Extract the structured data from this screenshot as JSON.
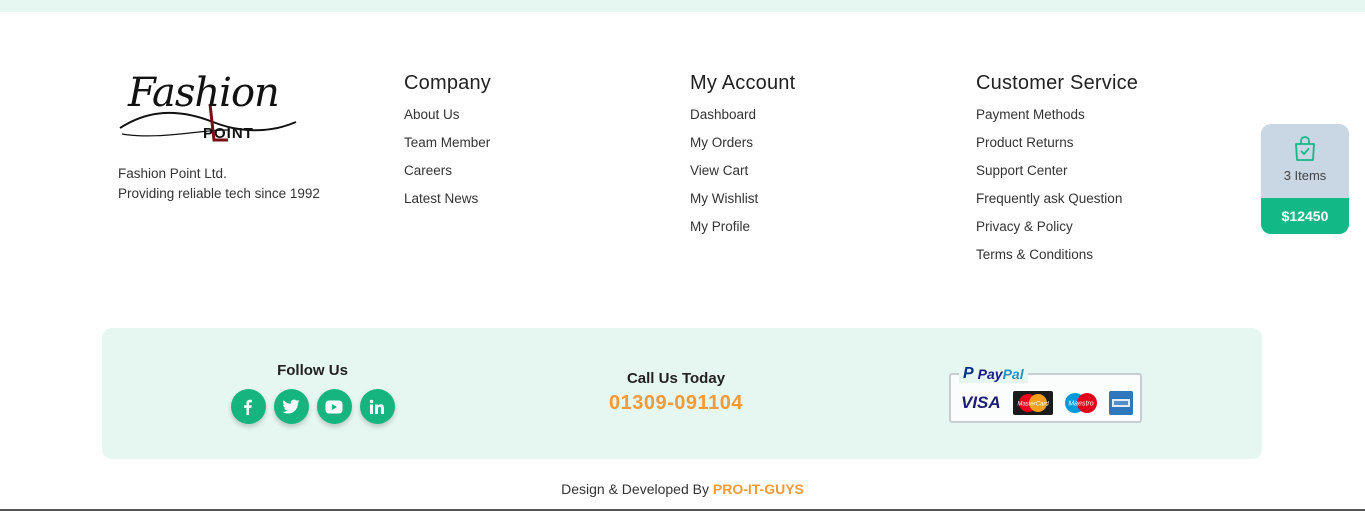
{
  "brand": {
    "logo_script": "Fashion",
    "logo_point": "POINT",
    "company_name": "Fashion Point Ltd.",
    "tagline": "Providing reliable tech since 1992"
  },
  "columns": {
    "company": {
      "title": "Company",
      "links": [
        "About Us",
        "Team Member",
        "Careers",
        "Latest News"
      ]
    },
    "account": {
      "title": "My Account",
      "links": [
        "Dashboard",
        "My Orders",
        "View Cart",
        "My Wishlist",
        "My Profile"
      ]
    },
    "service": {
      "title": "Customer Service",
      "links": [
        "Payment Methods",
        "Product Returns",
        "Support Center",
        "Frequently ask Question",
        "Privacy & Policy",
        "Terms & Conditions"
      ]
    }
  },
  "cart": {
    "items_label": "3 Items",
    "total": "$12450",
    "icon": "shopping-bag-check-icon"
  },
  "follow": {
    "title": "Follow Us",
    "icons": [
      "facebook-icon",
      "twitter-icon",
      "youtube-icon",
      "linkedin-icon"
    ]
  },
  "call": {
    "title": "Call Us Today",
    "number": "01309-091104"
  },
  "payment": {
    "paypal_text_1": "Pay",
    "paypal_text_2": "Pal",
    "paypal_mark": "P",
    "visa": "VISA",
    "mastercard_text": "MasterCard",
    "maestro_text": "Maestro"
  },
  "credit": {
    "prefix": "Design & Developed By",
    "developer": "PRO-IT-GUYS"
  },
  "colors": {
    "accent_green": "#16b57f",
    "accent_orange": "#f39a3b",
    "mint_background": "#e6f6f0"
  }
}
